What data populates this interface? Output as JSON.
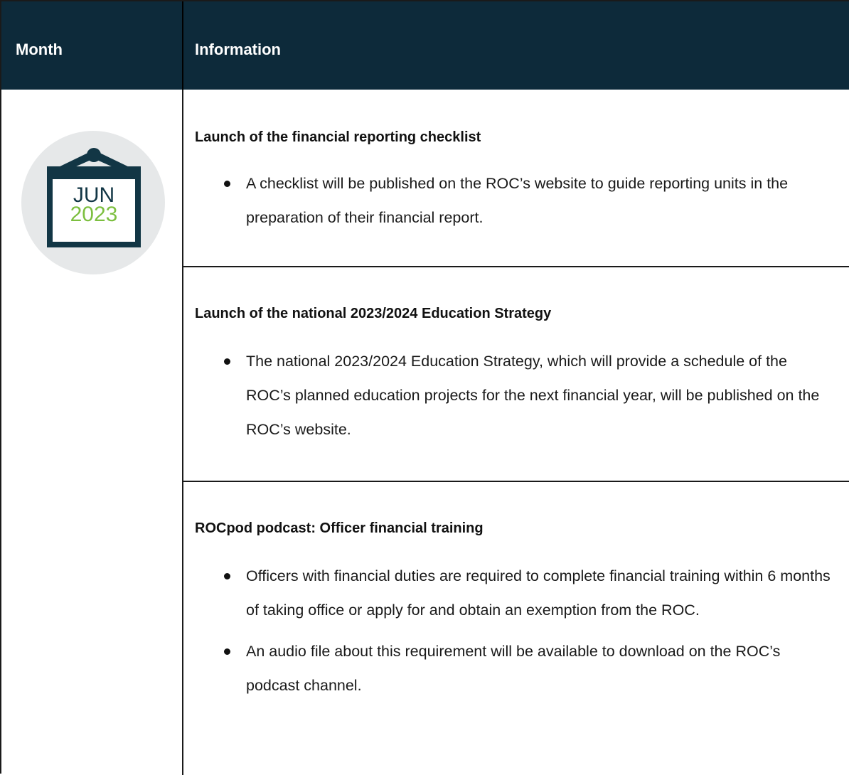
{
  "table": {
    "headers": {
      "month": "Month",
      "information": "Information"
    },
    "calendar_icon": {
      "month": "JUN",
      "year": "2023",
      "month_color": "#123645",
      "year_color": "#7cbf3f"
    },
    "sections": [
      {
        "title": "Launch of the financial reporting checklist",
        "bullets": [
          "A checklist will be published on the ROC’s website to guide reporting units in the preparation of their financial report."
        ]
      },
      {
        "title": "Launch of the national 2023/2024 Education Strategy",
        "bullets": [
          "The national 2023/2024 Education Strategy, which will provide a schedule of the ROC’s planned education projects for the next financial year, will be published on the ROC’s website."
        ]
      },
      {
        "title": "ROCpod podcast: Officer financial training",
        "bullets": [
          "Officers with financial duties are required to complete financial training within 6 months of taking office or apply for and obtain an exemption from the ROC.",
          "An audio file about this requirement will be available to download on the ROC’s podcast channel."
        ]
      }
    ],
    "header_bg": "#0d2a3a"
  }
}
